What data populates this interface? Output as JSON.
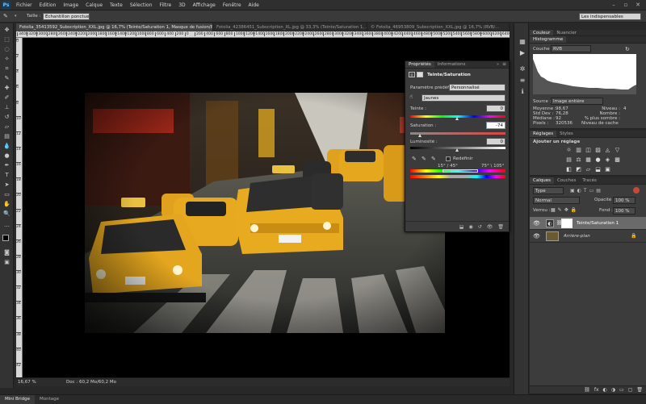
{
  "menubar": {
    "logo": "Ps",
    "items": [
      "Fichier",
      "Edition",
      "Image",
      "Calque",
      "Texte",
      "Sélection",
      "Filtre",
      "3D",
      "Affichage",
      "Fenêtre",
      "Aide"
    ],
    "window_controls": [
      "–",
      "▫",
      "✕"
    ]
  },
  "options": {
    "size_label": "Taille :",
    "size_value": "Echantillon ponctuel",
    "workspace": "Les indispensables"
  },
  "tabs": [
    {
      "label": "Fotolia_35413592_Subscription_XXL.jpg @ 16,7% (Teinte/Saturation 1, Masque de fusion/8) *",
      "active": true
    },
    {
      "label": "Fotolia_42386451_Subscription_XL.jpg @ 33,3% (Teinte/Saturation 1, ...",
      "active": false
    },
    {
      "label": "© Fotolia_46953809_Subscription_XXL.jpg @ 16,7% (RVB/...",
      "active": false
    }
  ],
  "ruler": {
    "h_ticks": [
      "3400",
      "3200",
      "3000",
      "2800",
      "2600",
      "2400",
      "2200",
      "2000",
      "1800",
      "1600",
      "1400",
      "1200",
      "1000",
      "800",
      "600",
      "400",
      "200",
      "0",
      "200",
      "400",
      "600",
      "800",
      "1000",
      "1200",
      "1400",
      "1600",
      "1800",
      "2000",
      "2200",
      "2400",
      "2600",
      "2800",
      "3000",
      "3200",
      "3400",
      "3600",
      "3800",
      "4000",
      "4200",
      "4400",
      "4600",
      "4800",
      "5000",
      "5200",
      "5400",
      "5600",
      "5800",
      "6000",
      "6200",
      "6400"
    ],
    "v_ticks": [
      "0",
      "2",
      "4",
      "6",
      "8",
      "10",
      "12",
      "14",
      "16",
      "18",
      "20",
      "22",
      "24",
      "26",
      "28",
      "30",
      "32",
      "34",
      "36",
      "38",
      "40",
      "42"
    ]
  },
  "status": {
    "zoom": "16,67 %",
    "doc": "Doc : 60,2 Mo/60,2 Mo"
  },
  "bottom_tabs": [
    "Mini Bridge",
    "Montage"
  ],
  "histogram": {
    "tabs": [
      "Histogramme"
    ],
    "channel_label": "Couche :",
    "channel_value": "RVB",
    "source_label": "Source :",
    "source_value": "Image entière",
    "stats": [
      {
        "label": "Moyenne :",
        "value": "98,67"
      },
      {
        "label": "Std Dev :",
        "value": "76,28"
      },
      {
        "label": "Médiane :",
        "value": "92"
      },
      {
        "label": "Pixels :",
        "value": "320536"
      }
    ],
    "stats2": [
      {
        "label": "Niveau :",
        "value": ""
      },
      {
        "label": "Nombre :",
        "value": ""
      },
      {
        "label": "% plus sombre :",
        "value": ""
      },
      {
        "label": "Niveau de cache :",
        "value": "4"
      }
    ]
  },
  "color_tabs": [
    "Couleur",
    "Nuancier"
  ],
  "adjustments": {
    "tabs": [
      "Réglages",
      "Styles"
    ],
    "title": "Ajouter un réglage",
    "row1": [
      "☼",
      "▥",
      "◫",
      "▨",
      "◬",
      "▽"
    ],
    "row2": [
      "▤",
      "⚖",
      "▦",
      "●",
      "◈",
      "▩"
    ],
    "row3": [
      "◧",
      "◩",
      "▱",
      "⬓",
      "▣"
    ]
  },
  "layers": {
    "tabs": [
      "Calques",
      "Couches",
      "Tracés"
    ],
    "filter": "Type",
    "blend_mode": "Normal",
    "opacity_label": "Opacité :",
    "opacity": "100 %",
    "lock_label": "Verrou :",
    "fill_label": "Fond :",
    "fill": "100 %",
    "items": [
      {
        "name": "Teinte/Saturation 1",
        "selected": true
      },
      {
        "name": "Arrière-plan",
        "selected": false
      }
    ],
    "footer_icons": [
      "⛓",
      "fx",
      "◐",
      "◑",
      "▭",
      "▢",
      "🗑"
    ]
  },
  "properties": {
    "tabs": [
      "Propriétés",
      "Informations"
    ],
    "title": "Teinte/Saturation",
    "preset_label": "Paramètre prédéfini :",
    "preset_value": "Personnalisé",
    "channel_value": "Jaunes",
    "hue_label": "Teinte :",
    "hue_value": "0",
    "sat_label": "Saturation :",
    "sat_value": "-74",
    "light_label": "Luminosité :",
    "light_value": "0",
    "colorize_label": "Redéfinir",
    "range_left": "15° / 45°",
    "range_right": "75° \\ 105°"
  }
}
